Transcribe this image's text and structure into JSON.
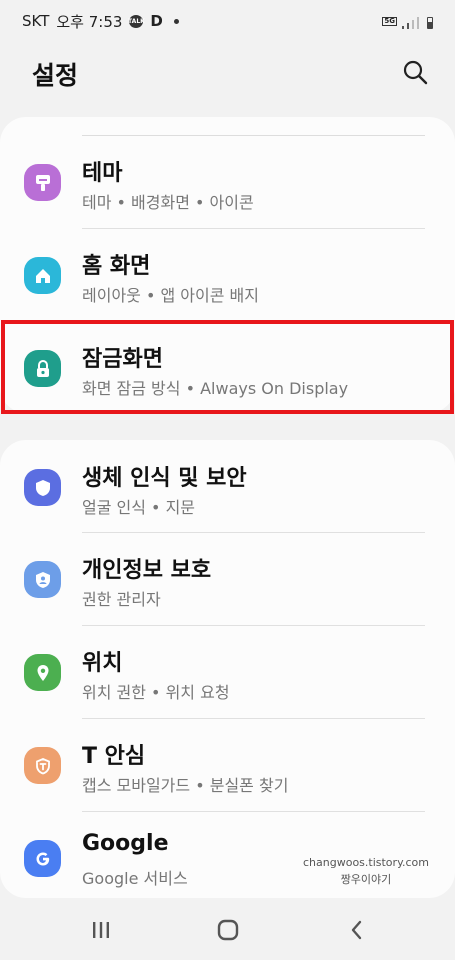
{
  "status_bar": {
    "carrier": "SKT",
    "time": "오후 7:53",
    "notification_d": "D",
    "talk_badge": "TALK",
    "network_label": "5G",
    "signal_level": 0.5,
    "battery_level": 0.6
  },
  "header": {
    "title": "설정",
    "search_icon": "search-icon"
  },
  "section_1": {
    "items": [
      {
        "title": "테마",
        "subtitle": "테마  •  배경화면  •  아이콘",
        "icon": "theme-brush-icon",
        "icon_color": "#b96fd6"
      },
      {
        "title": "홈 화면",
        "subtitle": "레이아웃  •  앱 아이콘 배지",
        "icon": "home-icon",
        "icon_color": "#2bb7d9"
      },
      {
        "title": "잠금화면",
        "subtitle": "화면 잠금 방식  •  Always On Display",
        "icon": "lock-icon",
        "icon_color": "#1f9e8c"
      }
    ]
  },
  "section_2": {
    "items": [
      {
        "title": "생체 인식 및 보안",
        "subtitle": "얼굴 인식  •  지문",
        "icon": "shield-icon",
        "icon_color": "#5b6ee1"
      },
      {
        "title": "개인정보 보호",
        "subtitle": "권한 관리자",
        "icon": "privacy-shield-icon",
        "icon_color": "#6d9ee8"
      },
      {
        "title": "위치",
        "subtitle": "위치 권한  •  위치 요청",
        "icon": "location-pin-icon",
        "icon_color": "#4caf50"
      },
      {
        "title": "T 안심",
        "subtitle": "캡스 모바일가드  •  분실폰 찾기",
        "icon": "t-safe-icon",
        "icon_color": "#eea06e"
      },
      {
        "title": "Google",
        "subtitle": "Google 서비스",
        "icon": "google-icon",
        "icon_color": "#4a7ef2"
      }
    ]
  },
  "highlight_color": "#e8171b",
  "watermark": {
    "line1": "changwoos.tistory.com",
    "line2": "짱우이야기"
  },
  "nav_bar": {
    "recent": "recent-apps-icon",
    "home": "home-button-icon",
    "back": "back-icon"
  }
}
